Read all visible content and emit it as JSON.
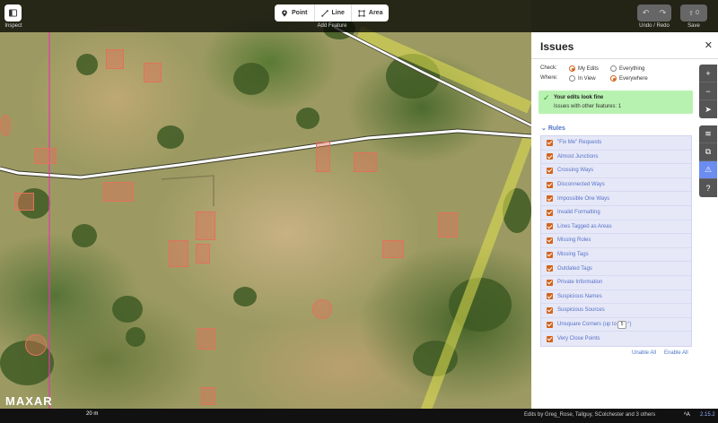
{
  "toolbar": {
    "inspect_label": "Inspect",
    "point_label": "Point",
    "line_label": "Line",
    "area_label": "Area",
    "add_feature_label": "Add Feature",
    "undo_redo_label": "Undo / Redo",
    "save_label": "Save",
    "save_count": "0"
  },
  "issues": {
    "title": "Issues",
    "check_label": "Check:",
    "check_options": [
      "My Edits",
      "Everything"
    ],
    "check_selected": "My Edits",
    "where_label": "Where:",
    "where_options": [
      "In View",
      "Everywhere"
    ],
    "where_selected": "Everywhere",
    "ok_title": "Your edits look fine",
    "ok_subtitle": "Issues with other features: 1",
    "rules_label": "Rules",
    "rules": [
      "\"Fix Me\" Requests",
      "Almost Junctions",
      "Crossing Ways",
      "Disconnected Ways",
      "Impossible One Ways",
      "Invalid Formatting",
      "Lines Tagged as Areas",
      "Mismatched Geometry",
      "Missing Roles",
      "Missing Tags",
      "Outdated Tags",
      "Private Information",
      "Suspicious Names",
      "Unsquare Corners (up to",
      "Very Close Points"
    ],
    "unsquare_degrees": "5",
    "unsquare_suffix": "°)",
    "disable_all": "Unable All",
    "enable_all": "Enable All"
  },
  "map": {
    "imagery_logo": "MAXAR",
    "scale_label": "20 m"
  },
  "footer": {
    "edits_by": "Edits by Greg_Rose, Tallguy, SColchester and 3 others",
    "version": "2.15.2"
  },
  "colors": {
    "accent": "#d4641b",
    "link": "#4d74c8",
    "ok_bg": "#b8f2b0",
    "building": "#e0735a",
    "active_tool": "#6b8cf0"
  }
}
